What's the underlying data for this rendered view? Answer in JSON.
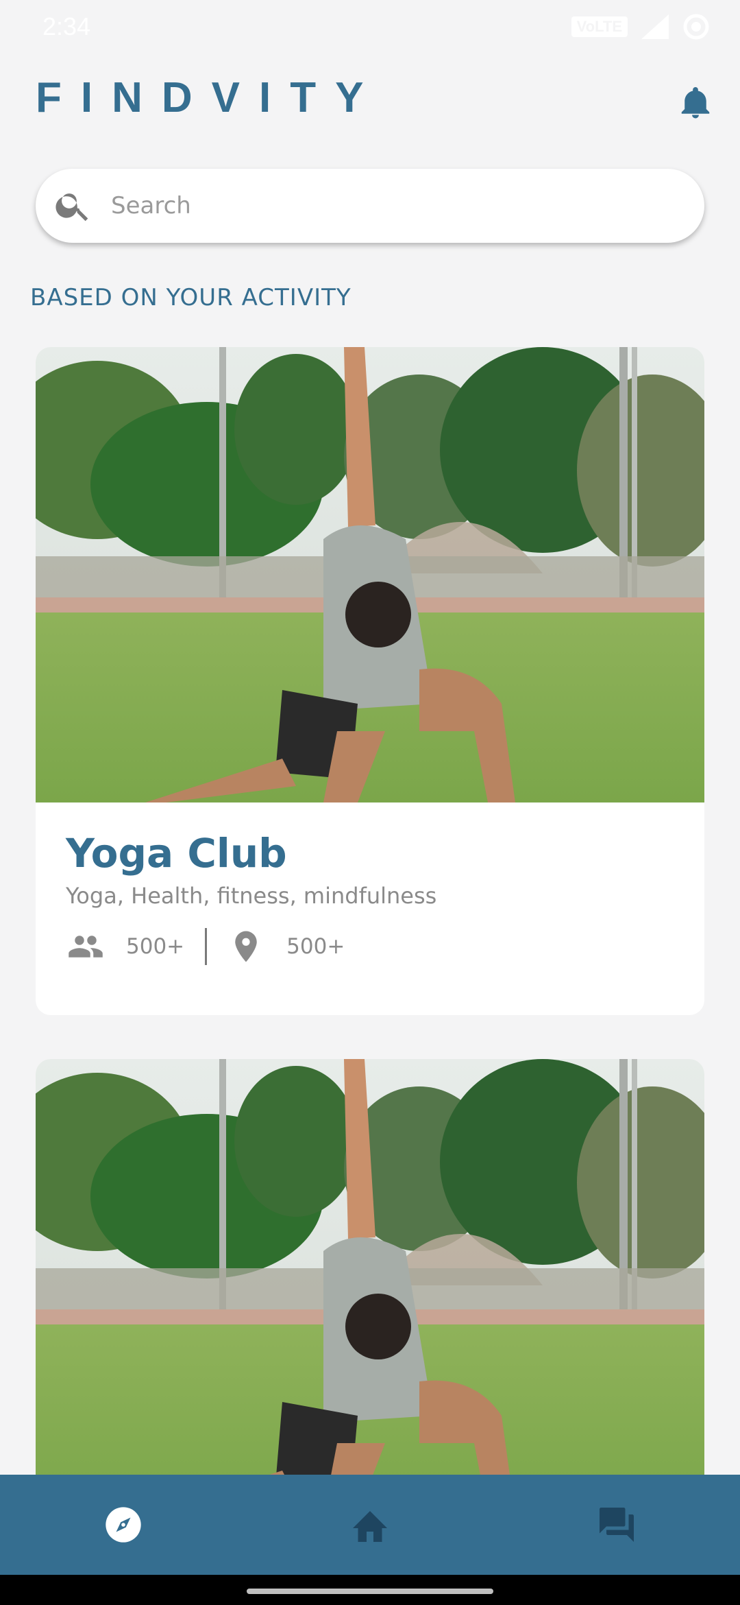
{
  "status_bar": {
    "time": "2:34",
    "network_badge": "VoLTE",
    "icons": [
      "volte-icon",
      "signal-icon",
      "sync-icon"
    ]
  },
  "header": {
    "brand": "FINDVITY",
    "notification_icon": "bell-icon"
  },
  "search": {
    "placeholder": "Search",
    "value": "",
    "icon": "search-icon"
  },
  "section": {
    "title": "BASED ON YOUR ACTIVITY"
  },
  "cards": [
    {
      "title": "Yoga Club",
      "tags": "Yoga, Health, fitness, mindfulness",
      "members": "500+",
      "locations": "500+",
      "image": "yoga-outdoor-photo"
    },
    {
      "title": "",
      "tags": "",
      "members": "",
      "locations": "",
      "image": "yoga-outdoor-photo"
    }
  ],
  "bottom_nav": {
    "items": [
      {
        "icon": "compass-icon",
        "active": true
      },
      {
        "icon": "home-icon",
        "active": false
      },
      {
        "icon": "chat-icon",
        "active": false
      }
    ]
  },
  "colors": {
    "accent": "#356E90",
    "background": "#F4F4F5",
    "card": "#FFFFFF",
    "muted_text": "#8A8A8A",
    "nav_inactive": "#1E4560"
  }
}
